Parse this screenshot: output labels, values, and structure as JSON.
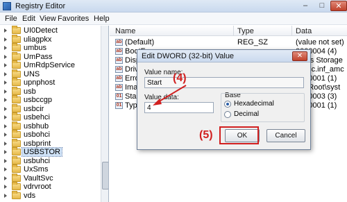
{
  "window": {
    "title": "Registry Editor",
    "min": "–",
    "max": "□",
    "close": "✕"
  },
  "menu": [
    "File",
    "Edit",
    "View",
    "Favorites",
    "Help"
  ],
  "tree": {
    "items": [
      {
        "label": "UI0Detect",
        "selected": false
      },
      {
        "label": "uliagpkx",
        "selected": false
      },
      {
        "label": "umbus",
        "selected": false
      },
      {
        "label": "UmPass",
        "selected": false
      },
      {
        "label": "UmRdpService",
        "selected": false
      },
      {
        "label": "UNS",
        "selected": false
      },
      {
        "label": "upnphost",
        "selected": false
      },
      {
        "label": "usb",
        "selected": false
      },
      {
        "label": "usbccgp",
        "selected": false
      },
      {
        "label": "usbcir",
        "selected": false
      },
      {
        "label": "usbehci",
        "selected": false
      },
      {
        "label": "usbhub",
        "selected": false
      },
      {
        "label": "usbohci",
        "selected": false
      },
      {
        "label": "usbprint",
        "selected": false
      },
      {
        "label": "USBSTOR",
        "selected": true
      },
      {
        "label": "usbuhci",
        "selected": false
      },
      {
        "label": "UxSms",
        "selected": false
      },
      {
        "label": "VaultSvc",
        "selected": false
      },
      {
        "label": "vdrvroot",
        "selected": false
      },
      {
        "label": "vds",
        "selected": false
      }
    ]
  },
  "list": {
    "columns": {
      "name": "Name",
      "type": "Type",
      "data": "Data"
    },
    "rows": [
      {
        "name": "(Default)",
        "type": "REG_SZ",
        "data": "(value not set)",
        "icon": "ab"
      },
      {
        "name": "BootF",
        "type": "",
        "data": "0000004 (4)",
        "icon": "ab"
      },
      {
        "name": "Displa",
        "type": "",
        "data": "Mass Storage",
        "icon": "ab"
      },
      {
        "name": "Driver",
        "type": "",
        "data": "scdsc.inf_amc",
        "icon": "ab"
      },
      {
        "name": "ErrorC",
        "type": "",
        "data": "0000001 (1)",
        "icon": "ab"
      },
      {
        "name": "Image",
        "type": "",
        "data": "temRoot\\syst",
        "icon": "ab"
      },
      {
        "name": "Start",
        "type": "",
        "data": "0000003 (3)",
        "icon": "01"
      },
      {
        "name": "Type",
        "type": "",
        "data": "0000001 (1)",
        "icon": "01"
      }
    ]
  },
  "dialog": {
    "title": "Edit DWORD (32-bit) Value",
    "close": "✕",
    "value_name_label": "Value name:",
    "value_name": "Start",
    "value_data_label": "Value data:",
    "value_data": "4",
    "base_label": "Base",
    "hex_label": "Hexadecimal",
    "dec_label": "Decimal",
    "ok": "OK",
    "cancel": "Cancel"
  },
  "annotations": {
    "step4": "(4)",
    "step5": "(5)"
  }
}
